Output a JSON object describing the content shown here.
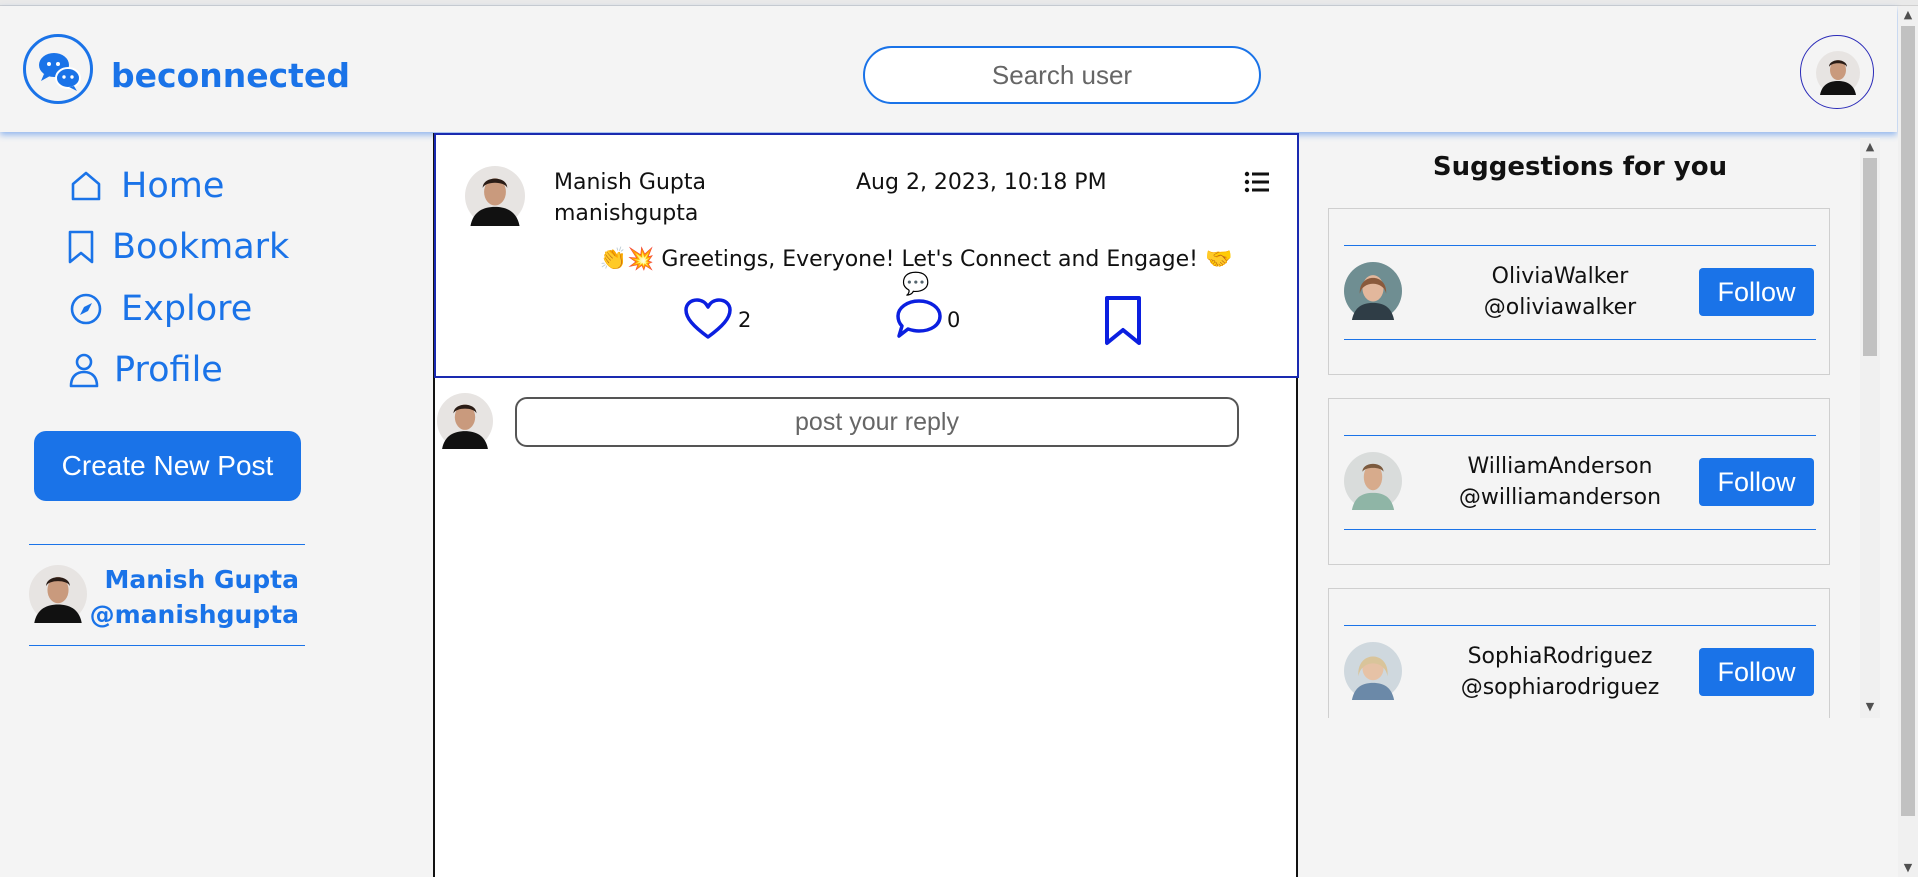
{
  "header": {
    "brand": "beconnected",
    "search_placeholder": "Search user"
  },
  "nav": {
    "items": [
      {
        "label": "Home",
        "icon": "home-icon"
      },
      {
        "label": "Bookmark",
        "icon": "bookmark-icon"
      },
      {
        "label": "Explore",
        "icon": "compass-icon"
      },
      {
        "label": "Profile",
        "icon": "user-icon"
      }
    ],
    "create_post_label": "Create New Post"
  },
  "current_user": {
    "name": "Manish Gupta",
    "handle": "@manishgupta"
  },
  "post": {
    "author_name": "Manish Gupta",
    "author_handle": "manishgupta",
    "timestamp": "Aug 2, 2023, 10:18 PM",
    "content": "👏💥 Greetings, Everyone! Let's Connect and Engage! 🤝💬",
    "likes": "2",
    "comments": "0"
  },
  "reply": {
    "placeholder": "post your reply"
  },
  "suggestions": {
    "title": "Suggestions for you",
    "users": [
      {
        "name": "OliviaWalker",
        "handle": "@oliviawalker",
        "follow_label": "Follow"
      },
      {
        "name": "WilliamAnderson",
        "handle": "@williamanderson",
        "follow_label": "Follow"
      },
      {
        "name": "SophiaRodriguez",
        "handle": "@sophiarodriguez",
        "follow_label": "Follow"
      }
    ]
  },
  "colors": {
    "accent": "#1a73e8",
    "icon_blue": "#0b1fe0",
    "background": "#f4f4f4"
  }
}
